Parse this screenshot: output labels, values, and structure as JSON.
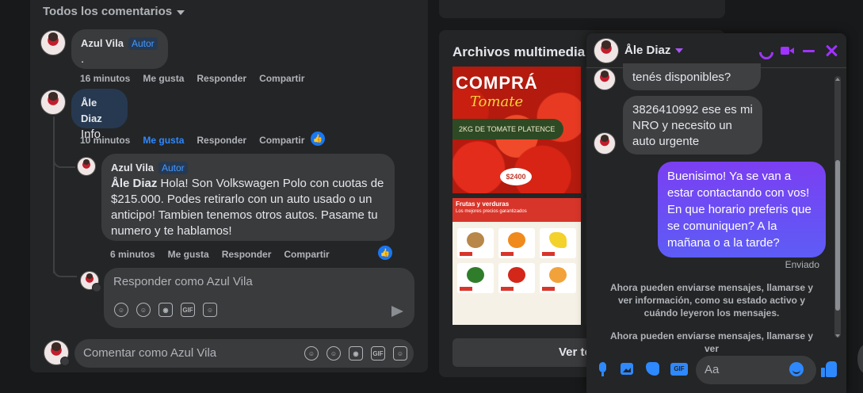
{
  "comments": {
    "sort_label": "Todos los comentarios",
    "author_tag": "Autor",
    "items": [
      {
        "author": "Azul Vila",
        "text": ".",
        "time": "16 minutos",
        "like": "Me gusta",
        "reply": "Responder",
        "share": "Compartir"
      },
      {
        "author": "Åle Diaz",
        "text": "Info",
        "time": "10 minutos",
        "like": "Me gusta",
        "reply": "Responder",
        "share": "Compartir"
      }
    ],
    "reply": {
      "author": "Azul Vila",
      "mention": "Åle Diaz",
      "text": "Hola! Son Volkswagen Polo con cuotas de $215.000. Podes retirarlo con un auto usado o un anticipo! Tambien tenemos otros autos. Pasame tu numero y te hablamos!",
      "time": "6 minutos",
      "like": "Me gusta",
      "reply": "Responder",
      "share": "Compartir"
    },
    "reply_placeholder": "Responder como Azul Vila",
    "comment_placeholder": "Comentar como Azul Vila"
  },
  "media": {
    "title": "Archivos multimedia r",
    "tomato": {
      "headline": "COMPRÁ",
      "sub": "Tomate",
      "banner": "2KG DE TOMATE PLATENCE",
      "price": "$2400"
    },
    "produce": {
      "header": "Frutas y verduras",
      "subheader": "Los mejores precios garantizados"
    },
    "see_more": "Ver to"
  },
  "chat": {
    "contact_name": "Åle Diaz",
    "messages_in": [
      "tenés disponibles?",
      "3826410992 ese es mi NRO y necesito un auto urgente"
    ],
    "message_out": "Buenisimo! Ya se van a estar contactando con vos! En que horario preferis que se comuniquen? A la mañana o a la tarde?",
    "sent_status": "Enviado",
    "system_message_1": "Ahora pueden enviarse mensajes, llamarse y ver información, como su estado activo y cuándo leyeron los mensajes.",
    "system_message_2": "Ahora pueden enviarse mensajes, llamarse y ver",
    "input_placeholder": "Aa"
  },
  "colors": {
    "accent_purple": "#a033ff",
    "messenger_blue": "#2e89ff",
    "facebook_blue": "#1877f2"
  }
}
